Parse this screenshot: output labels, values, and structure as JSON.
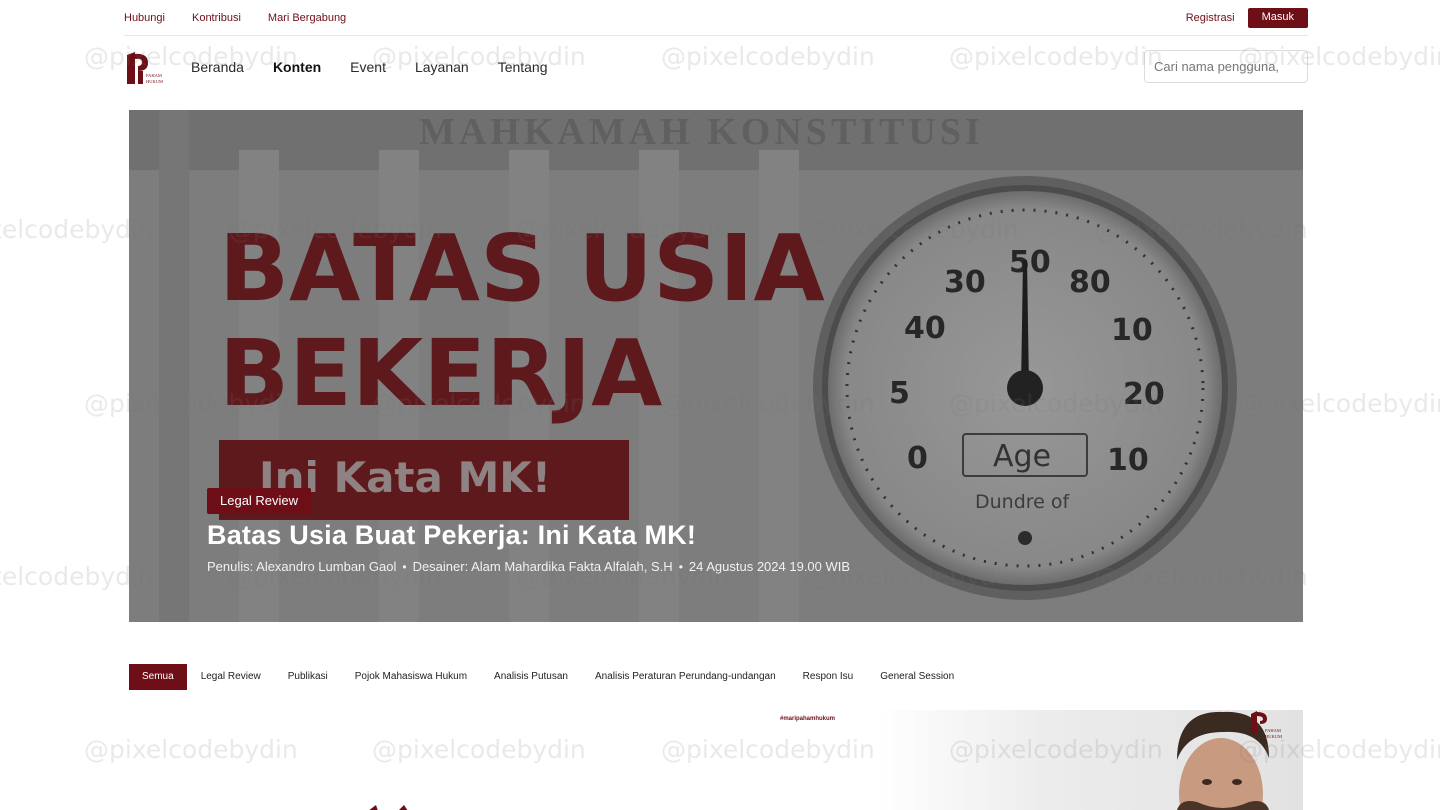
{
  "topbar": {
    "links": [
      "Hubungi",
      "Kontribusi",
      "Mari Bergabung"
    ],
    "register_label": "Registrasi",
    "login_label": "Masuk"
  },
  "nav": {
    "logo_text": "Paham Hukum",
    "links": [
      "Beranda",
      "Konten",
      "Event",
      "Layanan",
      "Tentang"
    ],
    "active": "Konten",
    "search_placeholder": "Cari nama pengguna,"
  },
  "hero": {
    "badge": "Legal Review",
    "title": "Batas Usia Buat Pekerja: Ini Kata MK!",
    "author": "Penulis: Alexandro Lumban Gaol",
    "designer": "Desainer: Alam Mahardika Fakta Alfalah, S.H",
    "date": "24 Agustus 2024 19.00 WIB",
    "image_text": {
      "building": "MAHKAMAH KONSTITUSI",
      "line1": "BATAS USIA",
      "line2": "BEKERJA",
      "line3": "Ini Kata MK!",
      "gauge_label": "Age",
      "gauge_sub": "Dundre of",
      "gauge_numbers": [
        "50",
        "30",
        "80",
        "40",
        "10",
        "5",
        "20",
        "0",
        "10"
      ]
    }
  },
  "tabs": {
    "items": [
      "Semua",
      "Legal Review",
      "Publikasi",
      "Pojok Mahasiswa Hukum",
      "Analisis Putusan",
      "Analisis Peraturan Perundang-undangan",
      "Respon Isu",
      "General Session"
    ],
    "active": "Semua"
  },
  "preview": {
    "tagline": "#maripahamhukum"
  },
  "watermark": "@pixelcodebydin",
  "colors": {
    "brand": "#6e0f18",
    "hero_red": "#8c1c22"
  }
}
